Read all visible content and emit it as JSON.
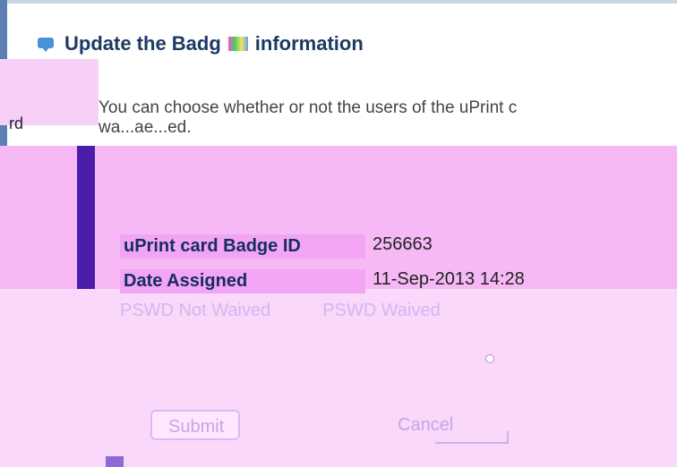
{
  "dialog": {
    "title_start": "Update the Badg",
    "title_end": "information",
    "description_line1": "You can choose whether or not the users of the uPrint c",
    "description_line2": "wa...ae...ed."
  },
  "fragment": {
    "left_text": "rd"
  },
  "details": [
    {
      "label": "uPrint card Badge ID",
      "value": "256663"
    },
    {
      "label": "Date Assigned",
      "value": "11-Sep-2013 14:28"
    }
  ],
  "waivers": {
    "left": "PSWD Not Waived",
    "right": "PSWD Waived"
  },
  "buttons": {
    "submit": "Submit",
    "cancel": "Cancel"
  },
  "colors": {
    "title": "#1d3a63",
    "accent": "#4a1daa",
    "panel": "#f6b9f6"
  },
  "icons": {
    "dialog": "speech-bubble-icon"
  }
}
